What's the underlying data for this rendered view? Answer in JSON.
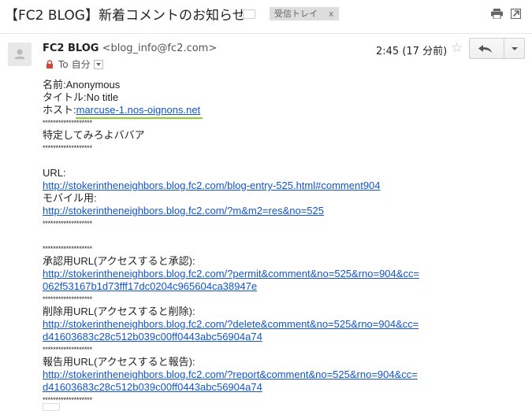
{
  "header": {
    "subject": "【FC2 BLOG】新着コメントのお知らせ",
    "label_chip": "受信トレイ",
    "label_chip_close": "x",
    "icons": [
      "label-outline-icon",
      "print-icon",
      "new-window-icon"
    ]
  },
  "message": {
    "sender_name": "FC2 BLOG",
    "sender_email": "<blog_info@fc2.com>",
    "to_label": "To",
    "recipient": "自分",
    "time": "2:45 (17 分前)",
    "star": "☆",
    "icons": [
      "avatar-icon",
      "lock-icon",
      "chevron-down-icon",
      "star-icon",
      "reply-icon"
    ]
  },
  "body": {
    "name_line": "名前:Anonymous",
    "title_line": "タイトル:No title",
    "host_label": "ホスト:",
    "host_value": "marcuse-1.nos-oignons.net",
    "sep": "*******************",
    "comment": "特定してみろよババア",
    "url_label": "URL:",
    "url_link": "http://stokerintheneighbors.blog.fc2.com/blog-entry-525.html#comment904",
    "mobile_label": "モバイル用:",
    "mobile_link": "http://stokerintheneighbors.blog.fc2.com/?m&m2=res&no=525",
    "approve_label": "承認用URL(アクセスすると承認):",
    "approve_link_1": "http://stokerintheneighbors.blog.fc2.com/?permit&comment&no=525&rno=904&cc=",
    "approve_link_2": "062f53167b1d73fff17dc0204c965604ca38947e",
    "delete_label": "削除用URL(アクセスすると削除):",
    "delete_link_1": "http://stokerintheneighbors.blog.fc2.com/?delete&comment&no=525&rno=904&cc=",
    "delete_link_2": "d41603683c28c512b039c00ff0443abc56904a74",
    "report_label": "報告用URL(アクセスすると報告):",
    "report_link_1": "http://stokerintheneighbors.blog.fc2.com/?report&comment&no=525&rno=904&cc=",
    "report_link_2": "d41603683c28c512b039c00ff0443abc56904a74"
  },
  "colors": {
    "link": "#1155cc",
    "highlight_underline": "#8ad12a",
    "chip_bg": "#dddddd",
    "lock": "#d44638"
  }
}
